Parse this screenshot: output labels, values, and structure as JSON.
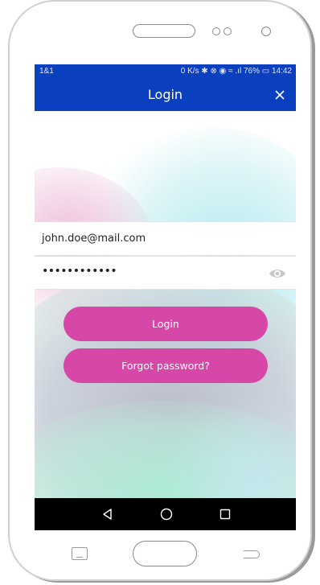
{
  "statusbar": {
    "carrier": "1&1",
    "right_text": "0 K/s ✱ ⊗ ◉ ≈ .ıl 76% ▭ 14:42",
    "battery": "76%",
    "time": "14:42"
  },
  "appbar": {
    "title": "Login",
    "close_icon": "close-icon"
  },
  "form": {
    "email_value": "john.doe@mail.com",
    "password_value": "••••••••••••",
    "eye_icon": "eye-icon"
  },
  "buttons": {
    "login_label": "Login",
    "forgot_label": "Forgot password?"
  },
  "navbar": {
    "back_icon": "back-triangle-icon",
    "home_icon": "home-circle-icon",
    "recent_icon": "recent-apps-square-icon"
  },
  "colors": {
    "appbar": "#0a3fbf",
    "button": "#d647a8",
    "navbar": "#000000"
  }
}
